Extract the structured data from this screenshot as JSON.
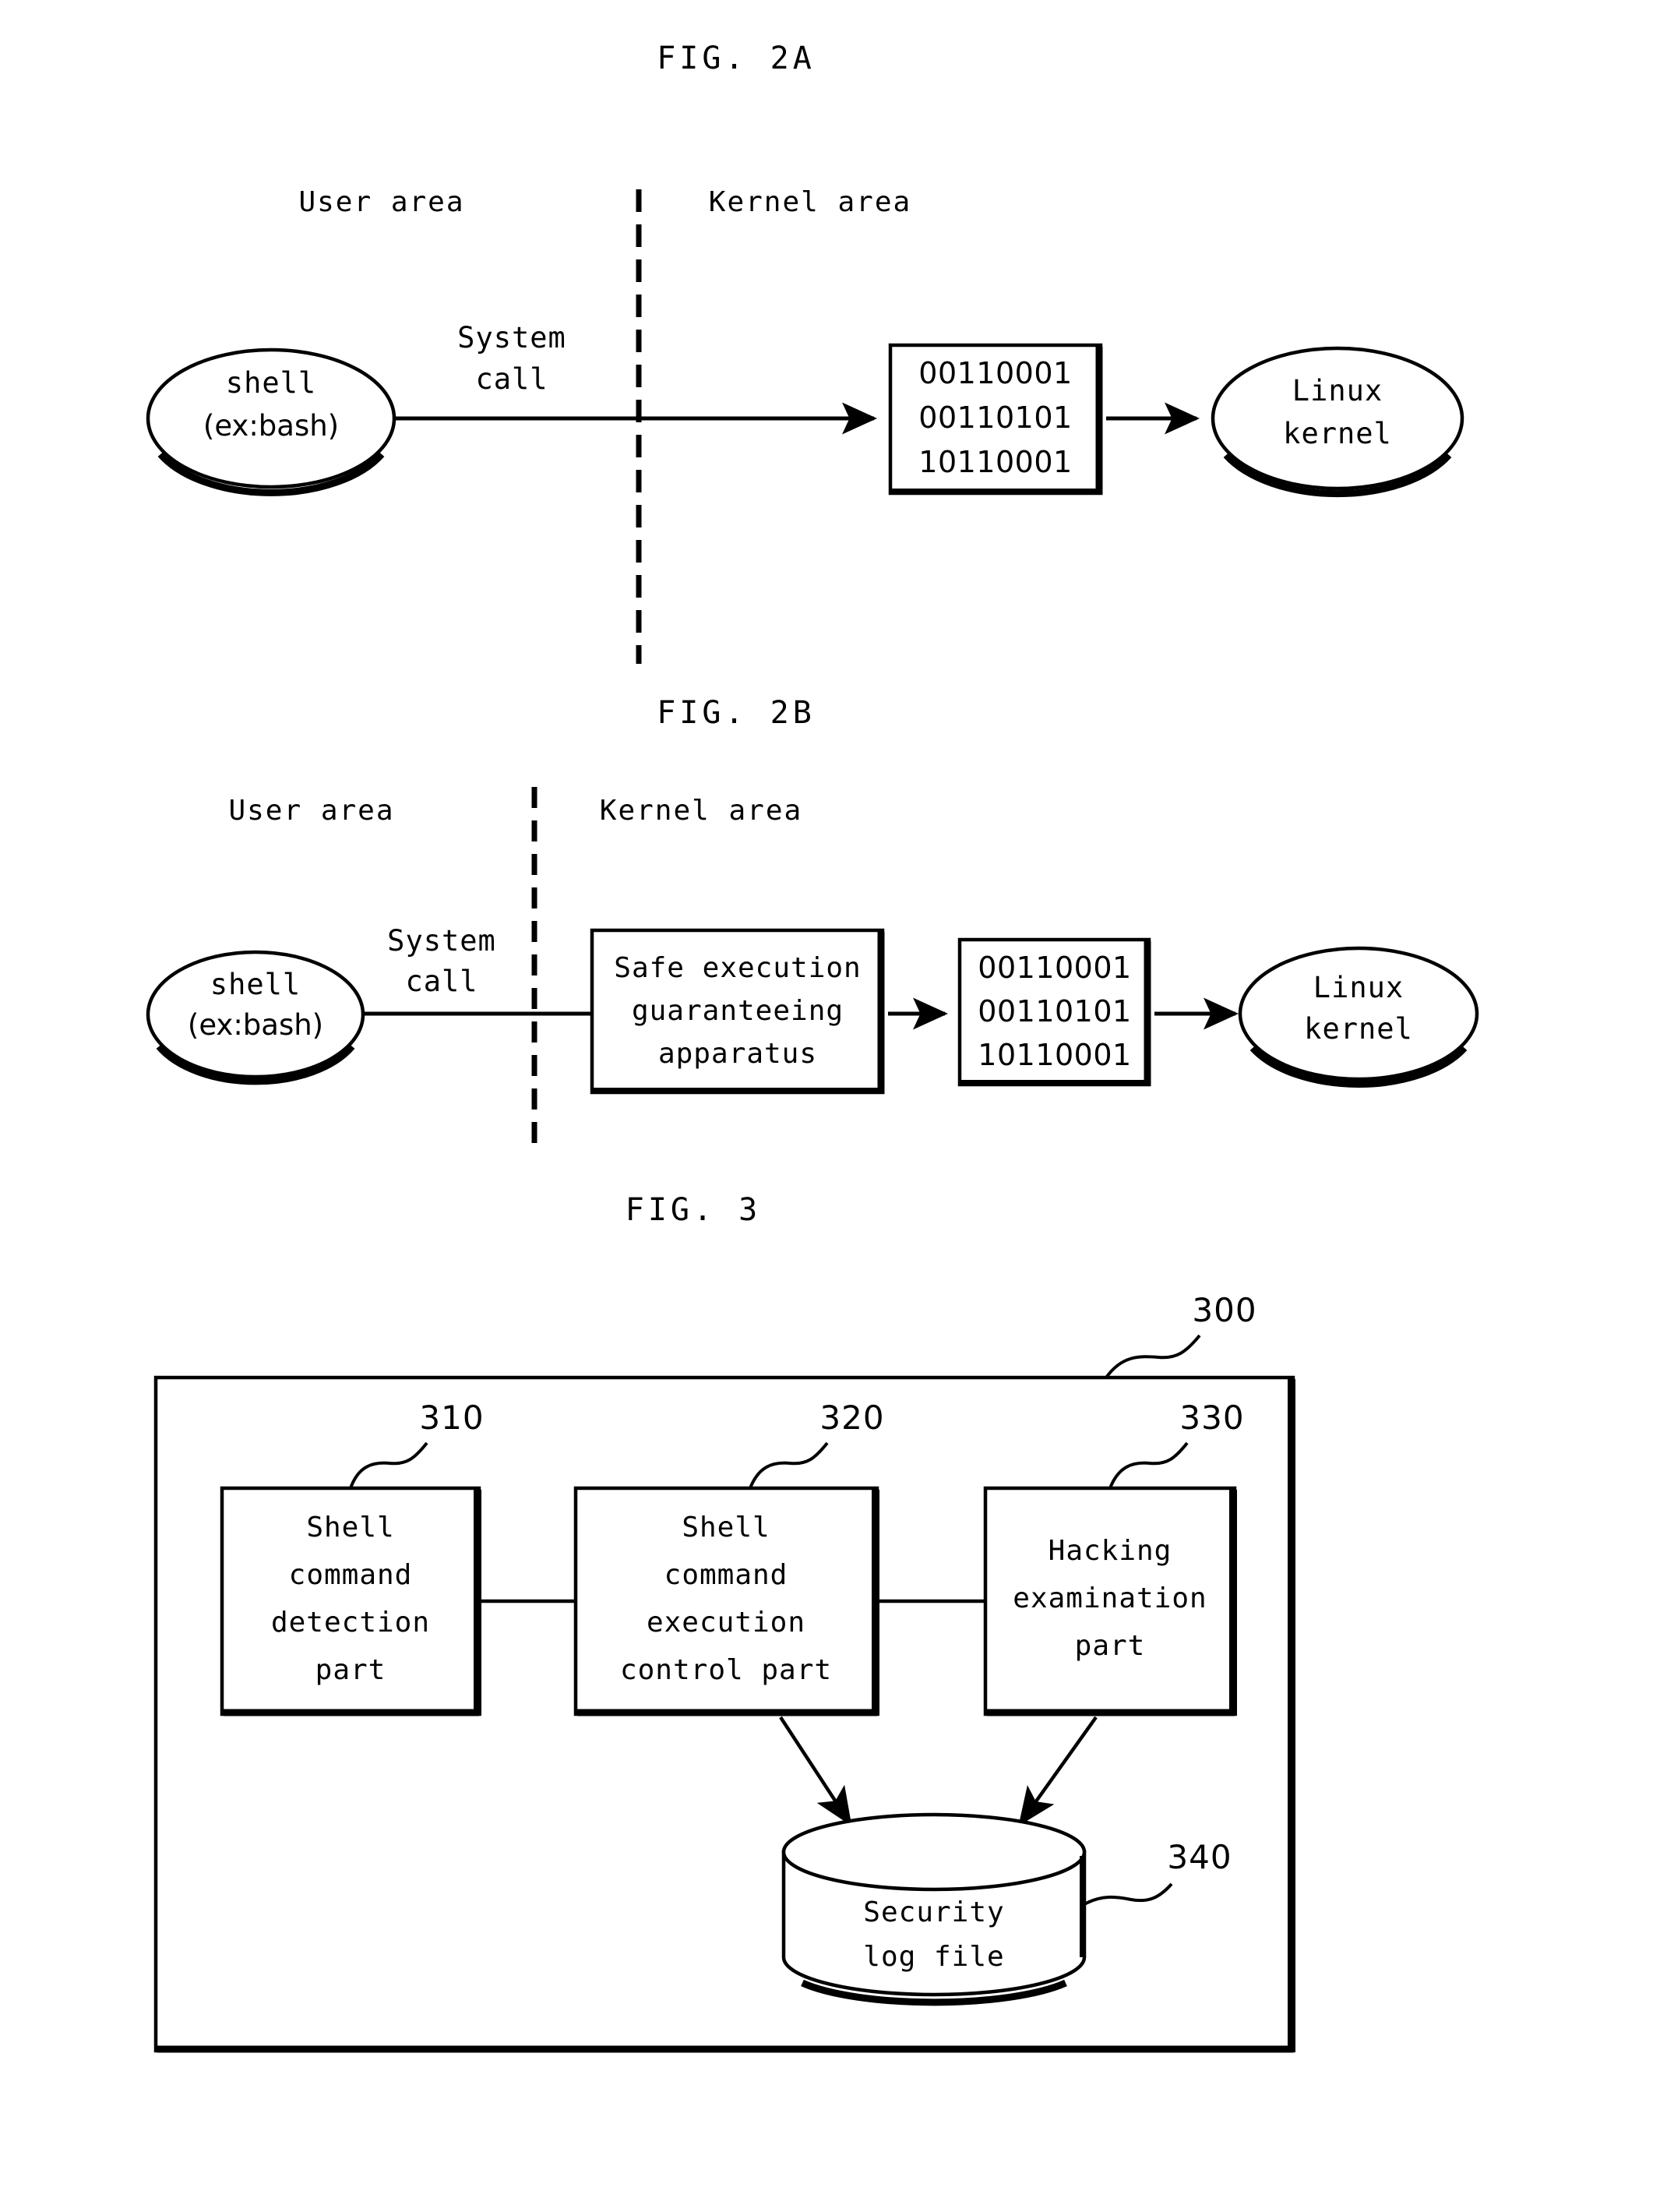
{
  "figures": {
    "fig2a": {
      "title": "FIG. 2A",
      "user_area_label": "User area",
      "kernel_area_label": "Kernel area",
      "shell_line1": "shell",
      "shell_line2": "(ex:bash)",
      "syscall_line1": "System",
      "syscall_line2": "call",
      "binary_line1": "00110001",
      "binary_line2": "00110101",
      "binary_line3": "10110001",
      "kernel_line1": "Linux",
      "kernel_line2": "kernel"
    },
    "fig2b": {
      "title": "FIG. 2B",
      "user_area_label": "User area",
      "kernel_area_label": "Kernel area",
      "shell_line1": "shell",
      "shell_line2": "(ex:bash)",
      "syscall_line1": "System",
      "syscall_line2": "call",
      "apparatus_line1": "Safe execution",
      "apparatus_line2": "guaranteeing",
      "apparatus_line3": "apparatus",
      "binary_line1": "00110001",
      "binary_line2": "00110101",
      "binary_line3": "10110001",
      "kernel_line1": "Linux",
      "kernel_line2": "kernel"
    },
    "fig3": {
      "title": "FIG. 3",
      "ref_outer": "300",
      "ref_detection": "310",
      "ref_control": "320",
      "ref_hacking": "330",
      "ref_logfile": "340",
      "detection_line1": "Shell",
      "detection_line2": "command",
      "detection_line3": "detection",
      "detection_line4": "part",
      "control_line1": "Shell",
      "control_line2": "command",
      "control_line3": "execution",
      "control_line4": "control part",
      "hacking_line1": "Hacking",
      "hacking_line2": "examination",
      "hacking_line3": "part",
      "logfile_line1": "Security",
      "logfile_line2": "log file"
    }
  },
  "colors": {
    "ink": "#000000",
    "paper": "#ffffff"
  }
}
